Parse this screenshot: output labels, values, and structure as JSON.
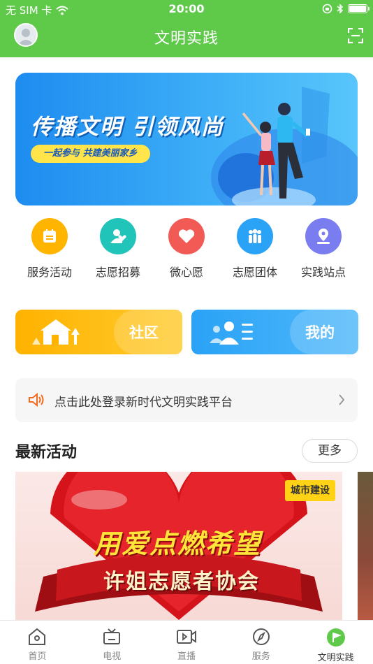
{
  "status_bar": {
    "carrier": "无 SIM 卡",
    "time": "20:00"
  },
  "header": {
    "title": "文明实践",
    "avatar_icon": "user-avatar-icon",
    "scan_icon": "scan-icon",
    "color": "#5fc94a"
  },
  "banner": {
    "title": "传播文明 引领风尚",
    "subtitle": "一起参与 共建美丽家乡"
  },
  "quick_menu": [
    {
      "label": "服务活动",
      "icon": "calendar-icon",
      "color": "#ffb400"
    },
    {
      "label": "志愿招募",
      "icon": "volunteer-icon",
      "color": "#21c4b8"
    },
    {
      "label": "微心愿",
      "icon": "heart-icon",
      "color": "#f25a55"
    },
    {
      "label": "志愿团体",
      "icon": "group-icon",
      "color": "#2aa2f6"
    },
    {
      "label": "实践站点",
      "icon": "location-icon",
      "color": "#7a7df0"
    }
  ],
  "cards": {
    "community": {
      "label": "社区",
      "icon": "house-icon",
      "color": "#ffb200"
    },
    "mine": {
      "label": "我的",
      "icon": "user-card-icon",
      "color": "#2aa2f6"
    }
  },
  "notice": {
    "text": "点击此处登录新时代文明实践平台",
    "icon": "speaker-icon"
  },
  "latest": {
    "title": "最新活动",
    "more_label": "更多",
    "activity": {
      "tag": "城市建设",
      "image_text1": "用爱点燃希望",
      "image_text2": "许姐志愿者协会"
    }
  },
  "tabbar": [
    {
      "label": "首页",
      "icon": "home-icon",
      "active": false
    },
    {
      "label": "电视",
      "icon": "tv-icon",
      "active": false
    },
    {
      "label": "直播",
      "icon": "live-video-icon",
      "active": false
    },
    {
      "label": "服务",
      "icon": "compass-icon",
      "active": false
    },
    {
      "label": "文明实践",
      "icon": "flag-icon",
      "active": true
    }
  ]
}
